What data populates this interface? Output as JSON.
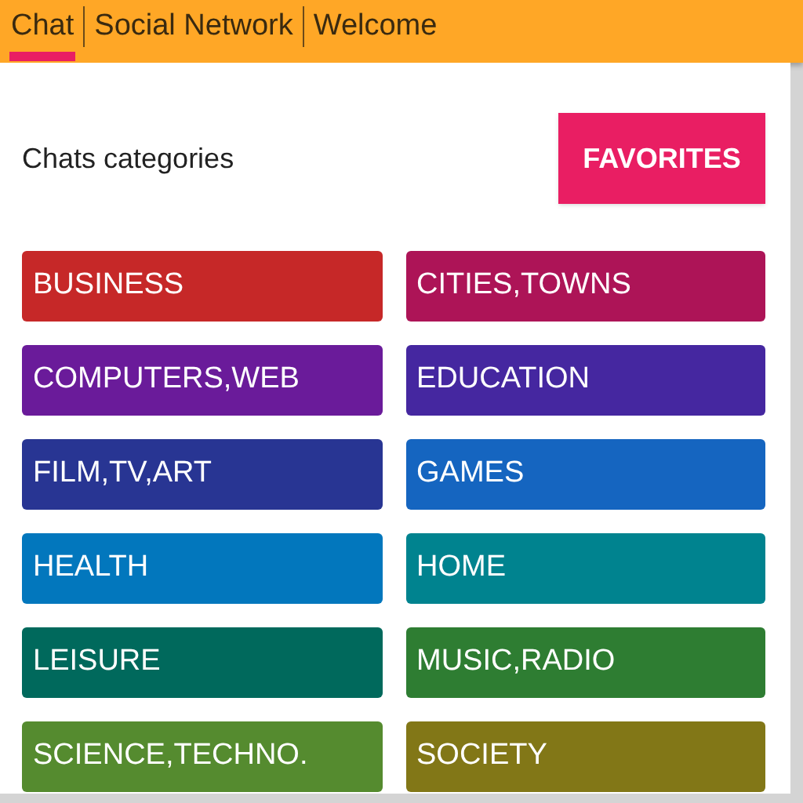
{
  "tabs": [
    {
      "label": "Chat",
      "selected": true
    },
    {
      "label": "Social Network",
      "selected": false
    },
    {
      "label": "Welcome",
      "selected": false
    }
  ],
  "header": {
    "title": "Chats categories",
    "favorites_button": "FAVORITES"
  },
  "categories": [
    {
      "label": "BUSINESS",
      "color": "#c62828"
    },
    {
      "label": "CITIES,TOWNS",
      "color": "#ad1457"
    },
    {
      "label": "COMPUTERS,WEB",
      "color": "#6a1b9a"
    },
    {
      "label": "EDUCATION",
      "color": "#4527a0"
    },
    {
      "label": "FILM,TV,ART",
      "color": "#283593"
    },
    {
      "label": "GAMES",
      "color": "#1565c0"
    },
    {
      "label": "HEALTH",
      "color": "#0277bd"
    },
    {
      "label": "HOME",
      "color": "#00838f"
    },
    {
      "label": "LEISURE",
      "color": "#00695c"
    },
    {
      "label": "MUSIC,RADIO",
      "color": "#2e7d32"
    },
    {
      "label": "SCIENCE,TECHNO.",
      "color": "#558b2f"
    },
    {
      "label": "SOCIETY",
      "color": "#827717"
    }
  ]
}
